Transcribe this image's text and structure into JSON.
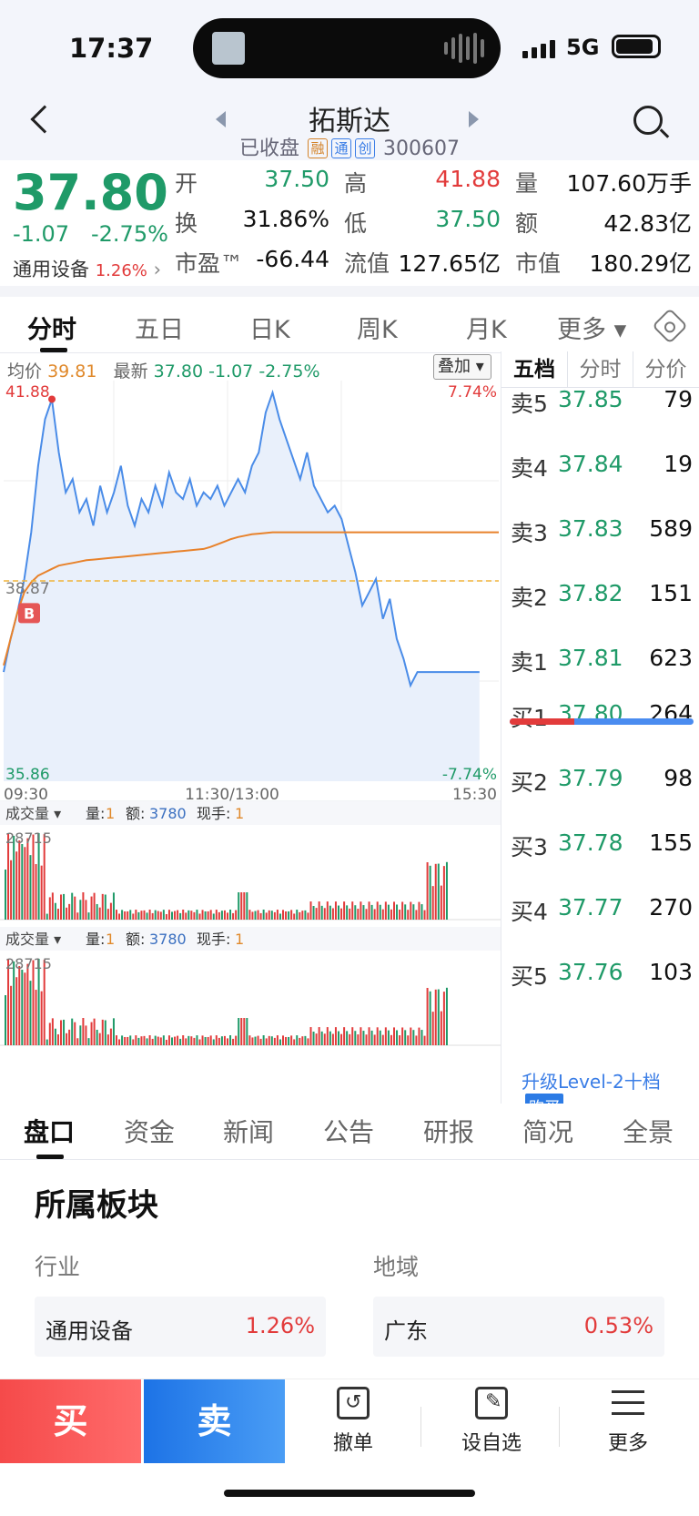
{
  "status_bar": {
    "time": "17:37",
    "network": "5G"
  },
  "nav": {
    "title": "拓斯达",
    "status": "已收盘",
    "tags": [
      "融",
      "通",
      "创"
    ],
    "code": "300607"
  },
  "quote": {
    "price": "37.80",
    "change": "-1.07",
    "change_pct": "-2.75%",
    "industry": "通用设备",
    "industry_pct": "1.26%",
    "rows": [
      [
        {
          "label": "开",
          "value": "37.50",
          "color": "#1f9a68"
        },
        {
          "label": "高",
          "value": "41.88",
          "color": "#e23b3b"
        },
        {
          "label": "量",
          "value": "107.60万手",
          "color": "#111111"
        }
      ],
      [
        {
          "label": "换",
          "value": "31.86%",
          "color": "#111111"
        },
        {
          "label": "低",
          "value": "37.50",
          "color": "#1f9a68"
        },
        {
          "label": "额",
          "value": "42.83亿",
          "color": "#111111"
        }
      ],
      [
        {
          "label": "市盈™",
          "value": "-66.44",
          "color": "#111111"
        },
        {
          "label": "流值",
          "value": "127.65亿",
          "color": "#111111"
        },
        {
          "label": "市值",
          "value": "180.29亿",
          "color": "#111111"
        }
      ]
    ]
  },
  "chart_tabs": [
    "分时",
    "五日",
    "日K",
    "周K",
    "月K",
    "更多 ▾"
  ],
  "chart_header": {
    "avg_label": "均价",
    "avg": "39.81",
    "latest_label": "最新",
    "latest": "37.80",
    "chg": "-1.07",
    "pct": "-2.75%",
    "overlay": "叠加"
  },
  "chart_data": {
    "type": "line",
    "title": "",
    "x_ticks": [
      "09:30",
      "11:30/13:00",
      "15:30"
    ],
    "y_max_label": "41.88",
    "y_min_label": "35.86",
    "y_mid_label": "38.87",
    "pct_max_label": "7.74%",
    "pct_min_label": "-7.74%",
    "ylim": [
      35.86,
      41.88
    ],
    "prev_close": 38.87,
    "series": [
      {
        "values": [
          37.5,
          38.0,
          38.4,
          38.9,
          39.6,
          40.6,
          41.3,
          41.6,
          40.8,
          40.2,
          40.4,
          39.9,
          40.1,
          39.7,
          40.3,
          39.9,
          40.2,
          40.6,
          40.0,
          39.7,
          40.1,
          39.9,
          40.3,
          40.0,
          40.5,
          40.2,
          40.1,
          40.4,
          40.0,
          40.2,
          40.1,
          40.3,
          40.0,
          40.2,
          40.4,
          40.2,
          40.6,
          40.8,
          41.4,
          41.7,
          41.3,
          41.0,
          40.7,
          40.4,
          40.8,
          40.3,
          40.1,
          39.9,
          40.0,
          39.8,
          39.4,
          39.0,
          38.5,
          38.7,
          38.9,
          38.3,
          38.6,
          38.0,
          37.7,
          37.3,
          37.5,
          37.5,
          37.5,
          37.5,
          37.5,
          37.5,
          37.5,
          37.5,
          37.5,
          37.5
        ]
      },
      {
        "values": [
          37.6,
          38.0,
          38.4,
          38.7,
          38.85,
          38.95,
          39.0,
          39.05,
          39.1,
          39.12,
          39.14,
          39.16,
          39.18,
          39.19,
          39.2,
          39.21,
          39.22,
          39.23,
          39.24,
          39.25,
          39.26,
          39.27,
          39.28,
          39.29,
          39.3,
          39.31,
          39.32,
          39.33,
          39.34,
          39.35,
          39.38,
          39.42,
          39.46,
          39.5,
          39.53,
          39.55,
          39.57,
          39.58,
          39.59,
          39.6,
          39.6,
          39.6,
          39.6,
          39.6,
          39.6,
          39.6,
          39.6,
          39.6,
          39.6,
          39.6,
          39.6,
          39.6,
          39.6,
          39.6,
          39.6,
          39.6,
          39.6,
          39.6,
          39.6,
          39.6,
          39.6,
          39.6,
          39.6,
          39.6,
          39.6,
          39.6,
          39.6,
          39.6,
          39.6,
          39.6
        ]
      }
    ]
  },
  "volume_panels": [
    {
      "label": "成交量 ▾",
      "q_label": "量:",
      "q": "1",
      "amt_label": "额:",
      "amt": "3780",
      "hand_label": "现手:",
      "hand": "1",
      "max": "28715"
    },
    {
      "label": "成交量 ▾",
      "q_label": "量:",
      "q": "1",
      "amt_label": "额:",
      "amt": "3780",
      "hand_label": "现手:",
      "hand": "1",
      "max": "28715"
    }
  ],
  "order_book": {
    "tabs": [
      "五档",
      "分时",
      "分价"
    ],
    "asks": [
      {
        "label": "卖5",
        "price": "37.85",
        "vol": "79"
      },
      {
        "label": "卖4",
        "price": "37.84",
        "vol": "19"
      },
      {
        "label": "卖3",
        "price": "37.83",
        "vol": "589"
      },
      {
        "label": "卖2",
        "price": "37.82",
        "vol": "151"
      },
      {
        "label": "卖1",
        "price": "37.81",
        "vol": "623"
      }
    ],
    "bids": [
      {
        "label": "买1",
        "price": "37.80",
        "vol": "264"
      },
      {
        "label": "买2",
        "price": "37.79",
        "vol": "98"
      },
      {
        "label": "买3",
        "price": "37.78",
        "vol": "155"
      },
      {
        "label": "买4",
        "price": "37.77",
        "vol": "270"
      },
      {
        "label": "买5",
        "price": "37.76",
        "vol": "103"
      }
    ],
    "ratio": 0.35,
    "upgrade": "升级Level-2十档",
    "buy_badge": "购买"
  },
  "section_tabs": [
    "盘口",
    "资金",
    "新闻",
    "公告",
    "研报",
    "简况",
    "全景"
  ],
  "sector": {
    "title": "所属板块",
    "industry_label": "行业",
    "region_label": "地域",
    "industry": {
      "name": "通用设备",
      "pct": "1.26%"
    },
    "region": {
      "name": "广东",
      "pct": "0.53%"
    }
  },
  "bottom": {
    "buy": "买",
    "sell": "卖",
    "actions": [
      "撤单",
      "设自选",
      "更多"
    ]
  }
}
